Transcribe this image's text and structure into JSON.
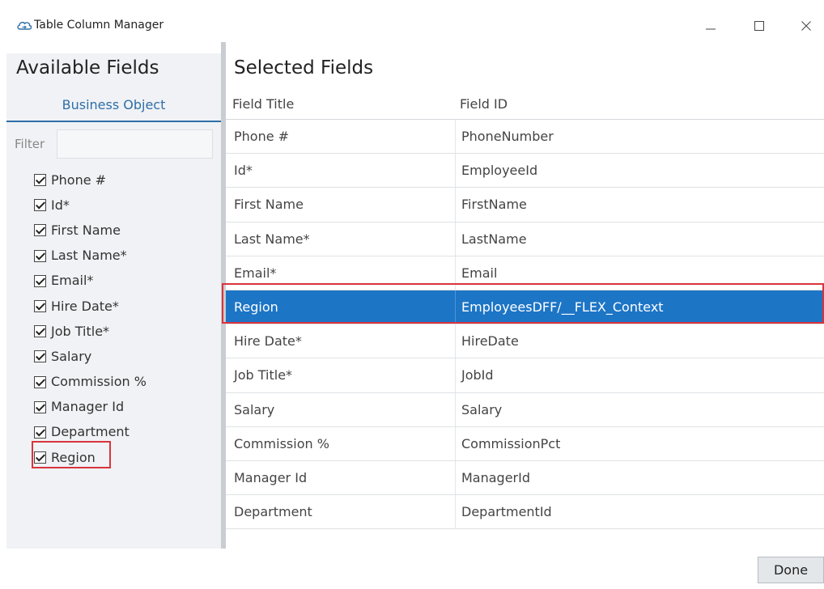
{
  "window": {
    "title": "Table Column Manager",
    "icon": "cloud-sync-icon"
  },
  "left": {
    "heading": "Available Fields",
    "tab": "Business Object",
    "filter_label": "Filter",
    "filter_value": "",
    "fields": [
      {
        "label": "Phone #",
        "checked": true
      },
      {
        "label": "Id*",
        "checked": true
      },
      {
        "label": "First Name",
        "checked": true
      },
      {
        "label": "Last Name*",
        "checked": true
      },
      {
        "label": "Email*",
        "checked": true
      },
      {
        "label": "Hire Date*",
        "checked": true
      },
      {
        "label": "Job Title*",
        "checked": true
      },
      {
        "label": "Salary",
        "checked": true
      },
      {
        "label": "Commission %",
        "checked": true
      },
      {
        "label": "Manager Id",
        "checked": true
      },
      {
        "label": "Department",
        "checked": true
      },
      {
        "label": "Region",
        "checked": true
      }
    ]
  },
  "right": {
    "heading": "Selected Fields",
    "columns": [
      "Field Title",
      "Field ID"
    ],
    "rows": [
      {
        "title": "Phone #",
        "id": "PhoneNumber",
        "selected": false
      },
      {
        "title": "Id*",
        "id": "EmployeeId",
        "selected": false
      },
      {
        "title": "First Name",
        "id": "FirstName",
        "selected": false
      },
      {
        "title": "Last Name*",
        "id": "LastName",
        "selected": false
      },
      {
        "title": "Email*",
        "id": "Email",
        "selected": false
      },
      {
        "title": "Region",
        "id": "EmployeesDFF/__FLEX_Context",
        "selected": true
      },
      {
        "title": "Hire Date*",
        "id": "HireDate",
        "selected": false
      },
      {
        "title": "Job Title*",
        "id": "JobId",
        "selected": false
      },
      {
        "title": "Salary",
        "id": "Salary",
        "selected": false
      },
      {
        "title": "Commission %",
        "id": "CommissionPct",
        "selected": false
      },
      {
        "title": "Manager Id",
        "id": "ManagerId",
        "selected": false
      },
      {
        "title": "Department",
        "id": "DepartmentId",
        "selected": false
      }
    ]
  },
  "footer": {
    "done_label": "Done"
  },
  "colors": {
    "selection": "#1d75c6",
    "highlight_border": "#d9343c",
    "tab_accent": "#2f6ea8"
  }
}
